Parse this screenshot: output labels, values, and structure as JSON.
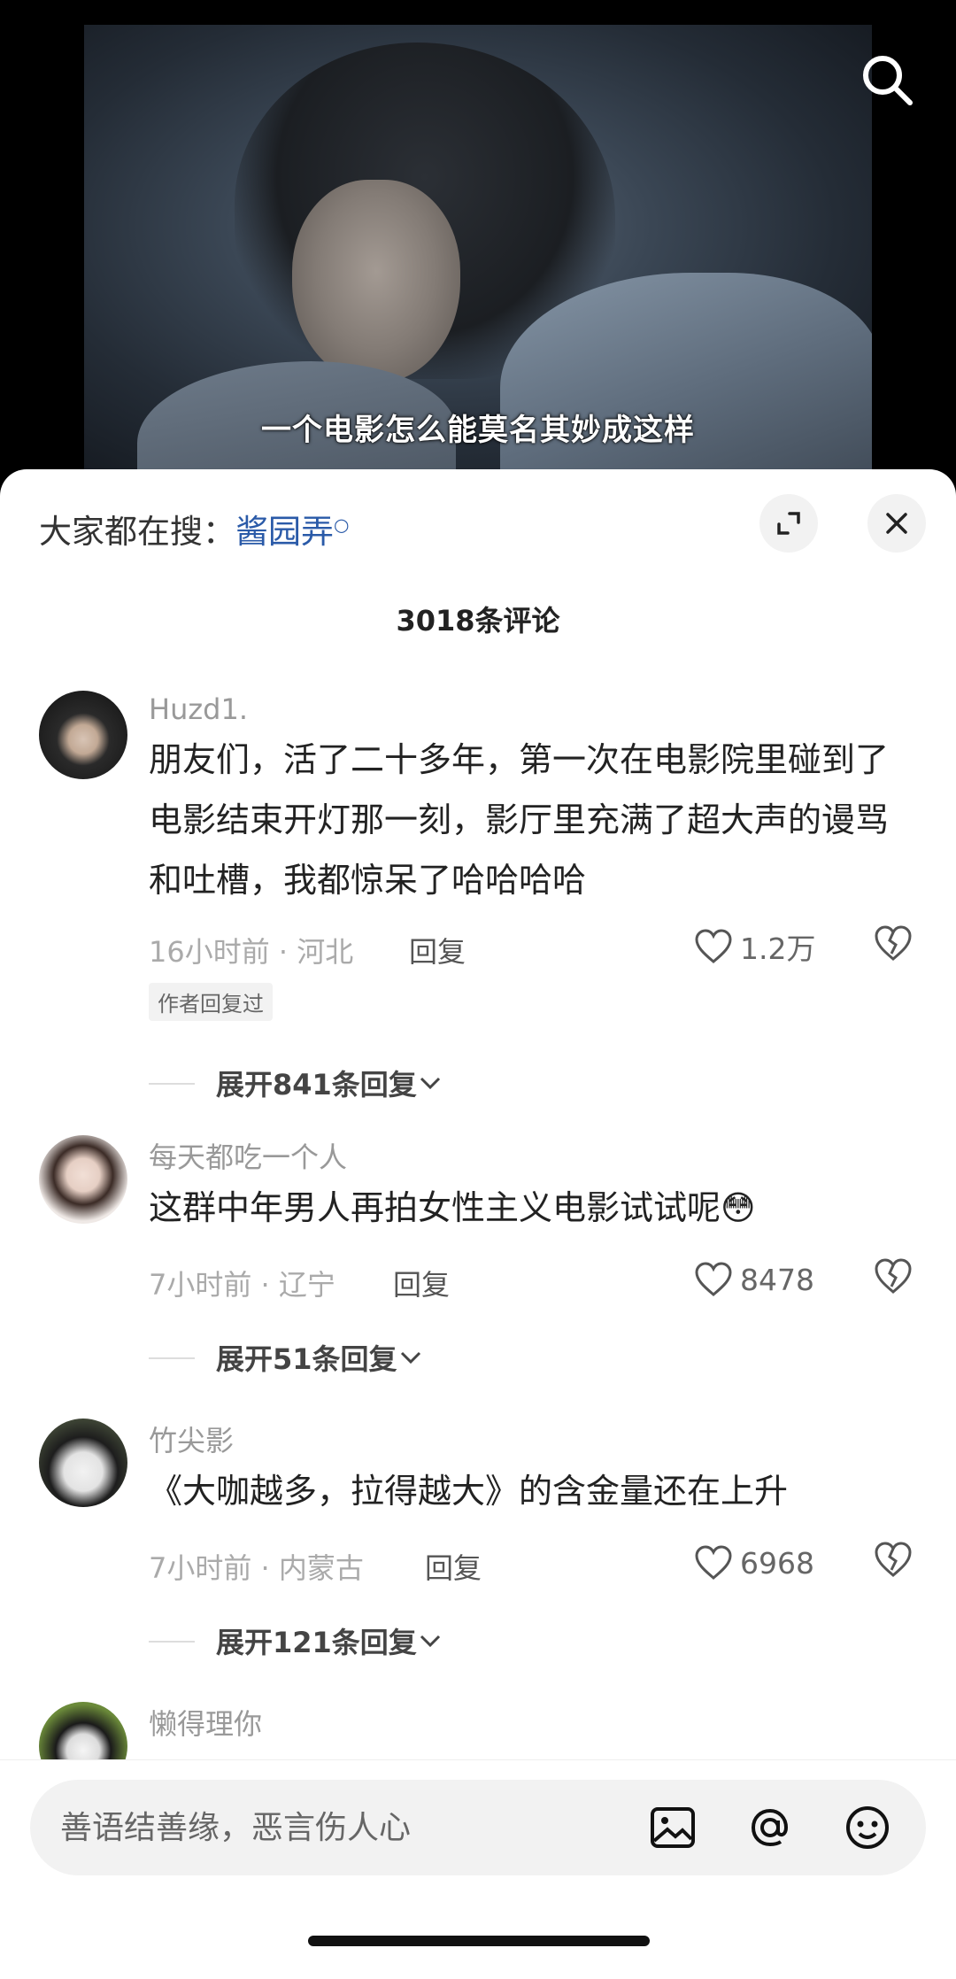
{
  "video": {
    "subtitle": "一个电影怎么能莫名其妙成这样",
    "search_icon": "search-icon"
  },
  "sheet": {
    "hot_search_prefix": "大家都在搜：",
    "hot_search_term": "酱园弄",
    "comment_count": "3018条评论",
    "expand_icon": "expand-icon",
    "close_icon": "close-icon"
  },
  "comments": [
    {
      "username": "Huzd1.",
      "text": "朋友们，活了二十多年，第一次在电影院里碰到了电影结束开灯那一刻，影厅里充满了超大声的谩骂和吐槽，我都惊呆了哈哈哈哈",
      "meta": "16小时前 · 河北",
      "reply_label": "回复",
      "likes": "1.2万",
      "badge": "作者回复过",
      "expand_label": "展开841条回复"
    },
    {
      "username": "每天都吃一个人",
      "text": "这群中年男人再拍女性主义电影试试呢😳",
      "meta": "7小时前 · 辽宁",
      "reply_label": "回复",
      "likes": "8478",
      "expand_label": "展开51条回复"
    },
    {
      "username": "竹尖影",
      "text": "《大咖越多，拉得越大》的含金量还在上升",
      "meta": "7小时前 · 内蒙古",
      "reply_label": "回复",
      "likes": "6968",
      "expand_label": "展开121条回复"
    },
    {
      "username": "懒得理你"
    }
  ],
  "input": {
    "placeholder": "善语结善缘，恶言伤人心",
    "icons": [
      "image-icon",
      "at-icon",
      "emoji-icon"
    ]
  },
  "colors": {
    "link": "#2a5aa8",
    "meta": "#aaaaaa",
    "background": "#ffffff"
  }
}
